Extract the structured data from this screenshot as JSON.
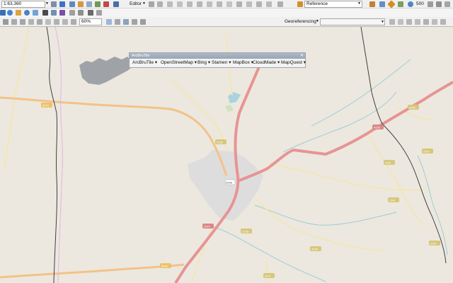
{
  "toolbar": {
    "scale_value": "1:63,360",
    "editor_label": "Editor",
    "reference_value": "Reference",
    "number_value": "500",
    "zoom_value": "60%",
    "georeferencing_label": "Georeferencing"
  },
  "arcbrutile": {
    "title": "ArcBruTile",
    "close": "✕",
    "menus": [
      "ArcBruTile",
      "OpenStreetMap",
      "Bing",
      "Stamen",
      "MapBox",
      "CloudMade",
      "MapQuest"
    ]
  },
  "map": {
    "road_labels": [
      "2472",
      "2450",
      "4155",
      "2259",
      "2526",
      "2261",
      "2341",
      "2243",
      "2027",
      "2328",
      "2261",
      "4026",
      "4026",
      "2027"
    ]
  }
}
